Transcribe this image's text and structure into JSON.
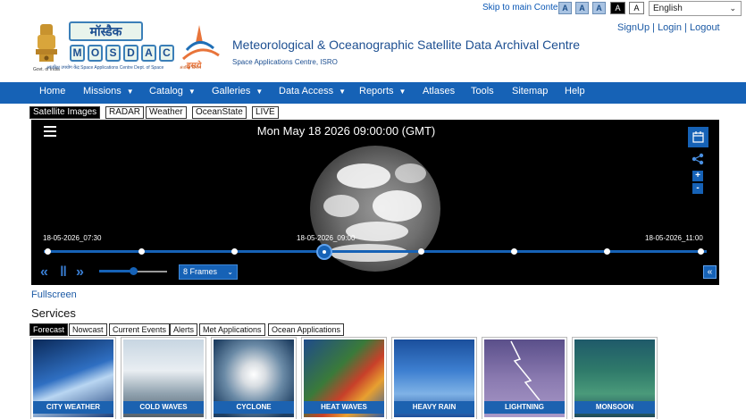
{
  "topbar": {
    "skip_link": "Skip to main Content",
    "font_buttons": [
      "A",
      "A",
      "A"
    ],
    "contrast_buttons": [
      "A",
      "A"
    ],
    "language": "English"
  },
  "header": {
    "emblem_caption": "Govt. of India",
    "logo_top": "मॉस्डैक",
    "logo_letters": [
      "M",
      "O",
      "S",
      "D",
      "A",
      "C"
    ],
    "logo_sub": "आंतरिक्ष उपयोग केंद्र  Space Applications Centre  Dept. of Space",
    "isro_text": "अंतरिक्ष विभाग",
    "title": "Meteorological & Oceanographic Satellite Data Archival Centre",
    "subtitle": "Space Applications Centre, ISRO",
    "signup": "SignUp",
    "login": "Login",
    "logout": "Logout",
    "sep": "|"
  },
  "nav": {
    "items": [
      {
        "label": "Home",
        "caret": ""
      },
      {
        "label": "Missions",
        "caret": "▼"
      },
      {
        "label": "Catalog",
        "caret": "▼"
      },
      {
        "label": "Galleries",
        "caret": "▼"
      },
      {
        "label": "Data Access",
        "caret": "▼"
      },
      {
        "label": "Reports",
        "caret": "▼"
      },
      {
        "label": "Atlases",
        "caret": ""
      },
      {
        "label": "Tools",
        "caret": ""
      },
      {
        "label": "Sitemap",
        "caret": ""
      },
      {
        "label": "Help",
        "caret": ""
      }
    ]
  },
  "image_tabs": [
    "Satellite Images",
    "RADAR",
    "Weather",
    "OceanState",
    "LIVE"
  ],
  "viewer": {
    "datetime": "Mon May 18 2026 09:00:00 (GMT)",
    "time_start": "18-05-2026_07:30",
    "time_current": "18-05-2026_09:00",
    "time_end": "18-05-2026_11:00",
    "rewind_icon": "«",
    "pause_icon": "‖",
    "forward_icon": "»",
    "frames_value": "8 Frames",
    "zoom_in": "+",
    "zoom_out": "-",
    "collapse_icon": "«"
  },
  "fullscreen_link": "Fullscreen",
  "services": {
    "heading": "Services",
    "tabs": [
      "Forecast",
      "Nowcast",
      "Current Events",
      "Alerts",
      "Met Applications",
      "Ocean Applications"
    ],
    "cards": [
      "CITY WEATHER",
      "COLD WAVES",
      "CYCLONE",
      "HEAT WAVES",
      "HEAVY RAIN",
      "LIGHTNING",
      "MONSOON"
    ]
  },
  "colors": {
    "nav_blue": "#1662b6",
    "card_label_blue": "#1c62b0",
    "link_blue": "#1c5aa5"
  }
}
